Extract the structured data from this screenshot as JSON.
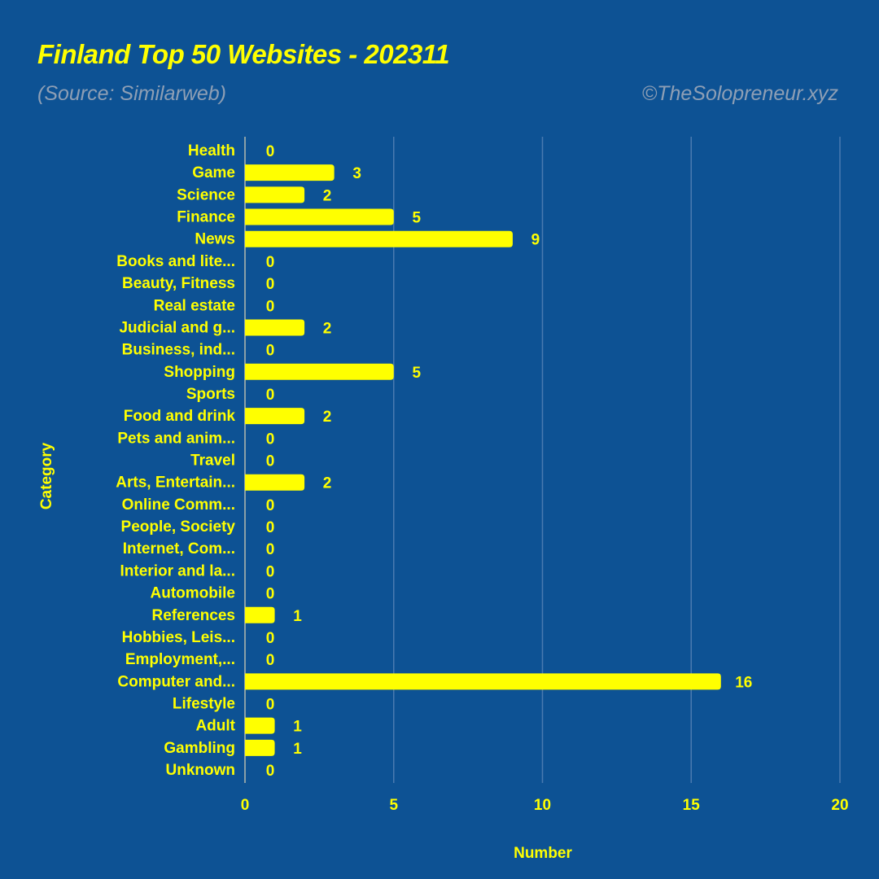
{
  "header": {
    "title": "Finland Top 50 Websites - 202311",
    "source": "(Source: Similarweb)",
    "credit": "©TheSolopreneur.xyz"
  },
  "colors": {
    "background": "#0d5294",
    "bar": "#ffff00",
    "text": "#ffff00",
    "subtitle": "#8e9fb5",
    "grid": "#4a7ab0"
  },
  "chart_data": {
    "type": "bar",
    "orientation": "horizontal",
    "title": "Finland Top 50 Websites - 202311",
    "subtitle": "(Source: Similarweb)",
    "xlabel": "Number",
    "ylabel": "Category",
    "xlim": [
      0,
      20
    ],
    "xticks": [
      "0",
      "5",
      "10",
      "15",
      "20"
    ],
    "grid": true,
    "categories": [
      "Health",
      "Game",
      "Science",
      "Finance",
      "News",
      "Books and lite...",
      "Beauty, Fitness",
      "Real estate",
      "Judicial and g...",
      "Business, ind...",
      "Shopping",
      "Sports",
      "Food and drink",
      "Pets and anim...",
      "Travel",
      "Arts, Entertain...",
      "Online Comm...",
      "People, Society",
      "Internet, Com...",
      "Interior and la...",
      "Automobile",
      "References",
      "Hobbies, Leis...",
      "Employment,...",
      "Computer and...",
      "Lifestyle",
      "Adult",
      "Gambling",
      "Unknown"
    ],
    "values": [
      0,
      3,
      2,
      5,
      9,
      0,
      0,
      0,
      2,
      0,
      5,
      0,
      2,
      0,
      0,
      2,
      0,
      0,
      0,
      0,
      0,
      1,
      0,
      0,
      16,
      0,
      1,
      1,
      0
    ]
  }
}
